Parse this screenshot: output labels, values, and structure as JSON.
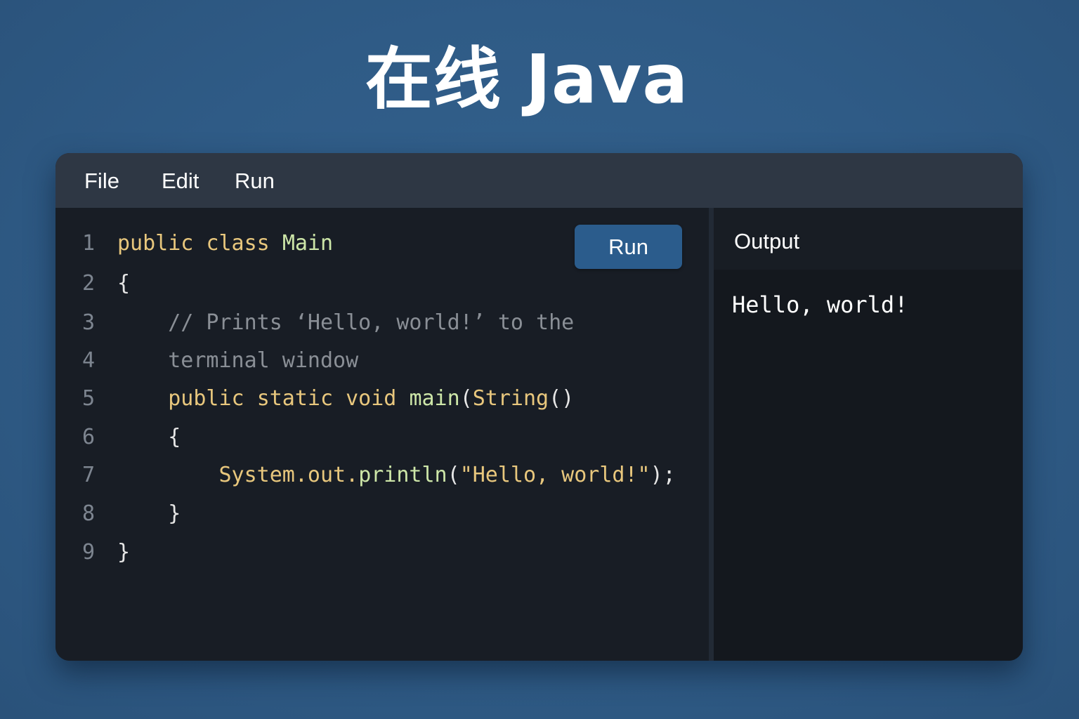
{
  "page": {
    "title": "在线 Java"
  },
  "menu": {
    "items": [
      "File",
      "Edit",
      "Run"
    ]
  },
  "editor": {
    "run_label": "Run",
    "lines": [
      {
        "number": "1",
        "tokens": [
          {
            "t": "public",
            "c": "kw"
          },
          {
            "t": " "
          },
          {
            "t": "class",
            "c": "kw"
          },
          {
            "t": " "
          },
          {
            "t": "Main",
            "c": "cls"
          }
        ]
      },
      {
        "number": "2",
        "tokens": [
          {
            "t": "{",
            "c": "punct"
          }
        ]
      },
      {
        "number": "3",
        "tokens": [
          {
            "t": "    // Prints ‘Hello, world!’ to the",
            "c": "comment"
          }
        ]
      },
      {
        "number": "4",
        "tokens": [
          {
            "t": "    terminal window",
            "c": "comment"
          }
        ]
      },
      {
        "number": "5",
        "tokens": [
          {
            "t": "    "
          },
          {
            "t": "public",
            "c": "kw"
          },
          {
            "t": " "
          },
          {
            "t": "static",
            "c": "kw"
          },
          {
            "t": " "
          },
          {
            "t": "void",
            "c": "kw"
          },
          {
            "t": " "
          },
          {
            "t": "main",
            "c": "method"
          },
          {
            "t": "(",
            "c": "punct"
          },
          {
            "t": "String",
            "c": "kw"
          },
          {
            "t": "()",
            "c": "punct"
          }
        ]
      },
      {
        "number": "6",
        "tokens": [
          {
            "t": "    "
          },
          {
            "t": "{",
            "c": "punct"
          }
        ]
      },
      {
        "number": "7",
        "tokens": [
          {
            "t": "        "
          },
          {
            "t": "System.out.",
            "c": "call"
          },
          {
            "t": "println",
            "c": "method"
          },
          {
            "t": "(",
            "c": "punct"
          },
          {
            "t": "\"Hello, world!\"",
            "c": "string"
          },
          {
            "t": ");",
            "c": "punct"
          }
        ]
      },
      {
        "number": "8",
        "tokens": [
          {
            "t": "    "
          },
          {
            "t": "}",
            "c": "punct"
          }
        ]
      },
      {
        "number": "9",
        "tokens": [
          {
            "t": "}",
            "c": "punct"
          }
        ]
      }
    ]
  },
  "output": {
    "title": "Output",
    "text": "Hello, world!"
  },
  "colors": {
    "background": "#2f5b86",
    "menu_bar": "#2e3744",
    "editor_bg": "#181d25",
    "output_bg": "#14181e",
    "run_button": "#2b5c8c",
    "keyword": "#e8c77d",
    "class_name": "#cde6a8",
    "comment": "#8a8f96",
    "line_number": "#7d8590"
  }
}
